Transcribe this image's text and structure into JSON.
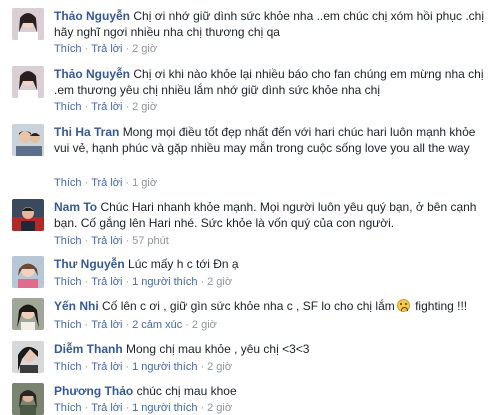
{
  "comments": [
    {
      "author": "Thảo Nguyễn",
      "text": "Chị ơi nhớ giữ dình sức khỏe nha ..em chúc chị xóm hồi phục .chị hãy nghĩ ngơi nhiều nha chị thương chị qa",
      "like_label": "Thích",
      "reply_label": "Trả lời",
      "time": "2 giờ"
    },
    {
      "author": "Thảo Nguyễn",
      "text": "Chị ơi khi nào khỏe lại nhiều báo cho fan chúng em mừng nha chị .em thương yêu chị nhiều lắm nhớ giữ dình sức khỏe nha chị",
      "like_label": "Thích",
      "reply_label": "Trả lời",
      "time": "2 giờ"
    },
    {
      "author": "Thi Ha Tran",
      "text": "Mong mọi điều tốt đẹp nhất đến với hari chúc hari luôn mạnh khỏe vui vẻ, hạnh phúc và gặp nhiều may mắn trong cuộc sống love you all the way",
      "like_label": "Thích",
      "reply_label": "Trả lời",
      "time": "1 giờ"
    },
    {
      "author": "Nam To",
      "text": "Chúc Hari nhanh khỏe mạnh. Mọi người luôn yêu quý bạn, ở bên cạnh bạn. Cố gắng lên Hari nhé. Sức khỏe là vốn quý của con người.",
      "like_label": "Thích",
      "reply_label": "Trả lời",
      "time": "57 phút"
    },
    {
      "author": "Thư Nguyễn",
      "text": "Lúc mấy h c tới Đn ạ",
      "like_label": "Thích",
      "reply_label": "Trả lời",
      "extra_label": "1 người thích",
      "time": "2 giờ"
    },
    {
      "author": "Yến Nhi",
      "text": "Cố lên c ơi , giữ gìn sức khỏe nha c , SF lo cho chị lắm",
      "text_after_emoji": "fighting !!!",
      "emoji": "sad-face-emoji",
      "like_label": "Thích",
      "reply_label": "Trả lời",
      "extra_label": "2 cảm xúc",
      "time": "2 giờ"
    },
    {
      "author": "Diễm Thanh",
      "text": "Mong chị mau khỏe , yêu chị <3<3",
      "like_label": "Thích",
      "reply_label": "Trả lời",
      "extra_label": "1 người thích",
      "time": "2 giờ"
    },
    {
      "author": "Phương Thảo",
      "text": "chúc chị mau khoe",
      "like_label": "Thích",
      "reply_label": "Trả lời",
      "extra_label": "1 người thích",
      "time": "2 giờ"
    }
  ]
}
